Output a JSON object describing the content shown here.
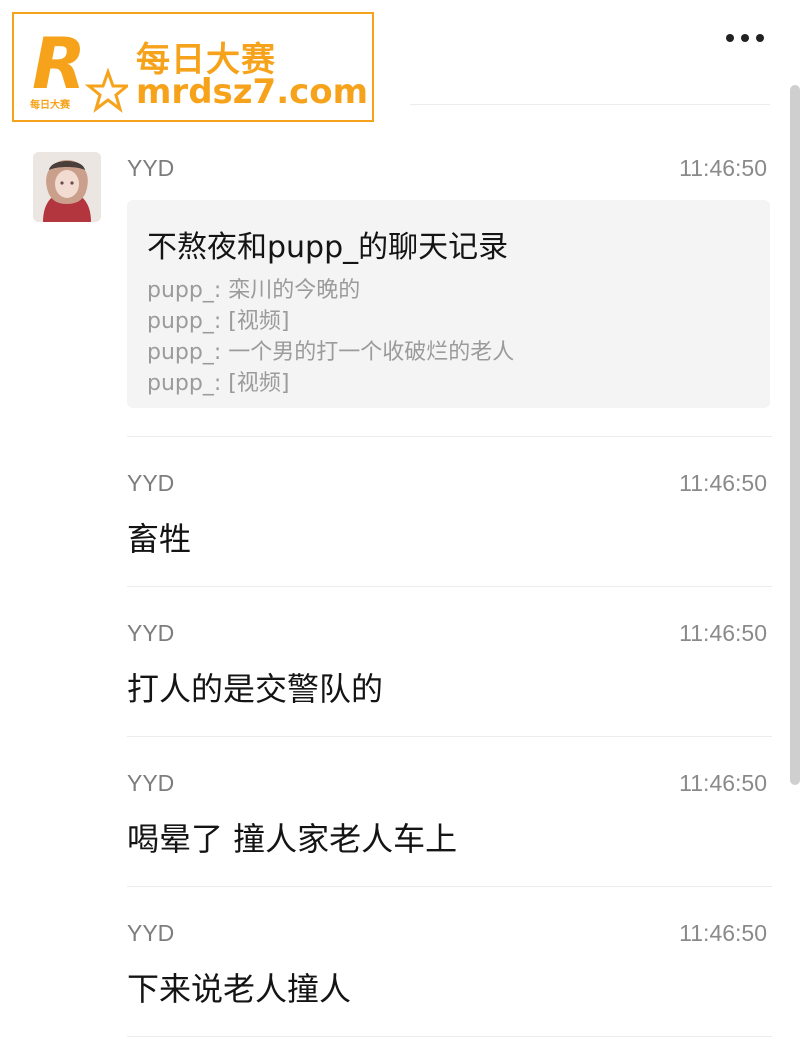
{
  "watermark": {
    "logo_letter": "R",
    "logo_small_text": "每日大赛",
    "cn_text": "每日大赛",
    "en_text": "mrdsz7.com"
  },
  "messages": [
    {
      "sender": "YYD",
      "time": "11:46:50",
      "type": "chat_record",
      "record": {
        "title": "不熬夜和pupp_的聊天记录",
        "lines": [
          "pupp_: 栾川的今晚的",
          "pupp_: [视频]",
          "pupp_: 一个男的打一个收破烂的老人",
          "pupp_: [视频]"
        ]
      }
    },
    {
      "sender": "YYD",
      "time": "11:46:50",
      "text": "畜牲"
    },
    {
      "sender": "YYD",
      "time": "11:46:50",
      "text": "打人的是交警队的"
    },
    {
      "sender": "YYD",
      "time": "11:46:50",
      "text": "喝晕了 撞人家老人车上"
    },
    {
      "sender": "YYD",
      "time": "11:46:50",
      "text": "下来说老人撞人"
    }
  ],
  "icons": {
    "back": "chevron-left-icon",
    "more": "more-dots-icon"
  }
}
